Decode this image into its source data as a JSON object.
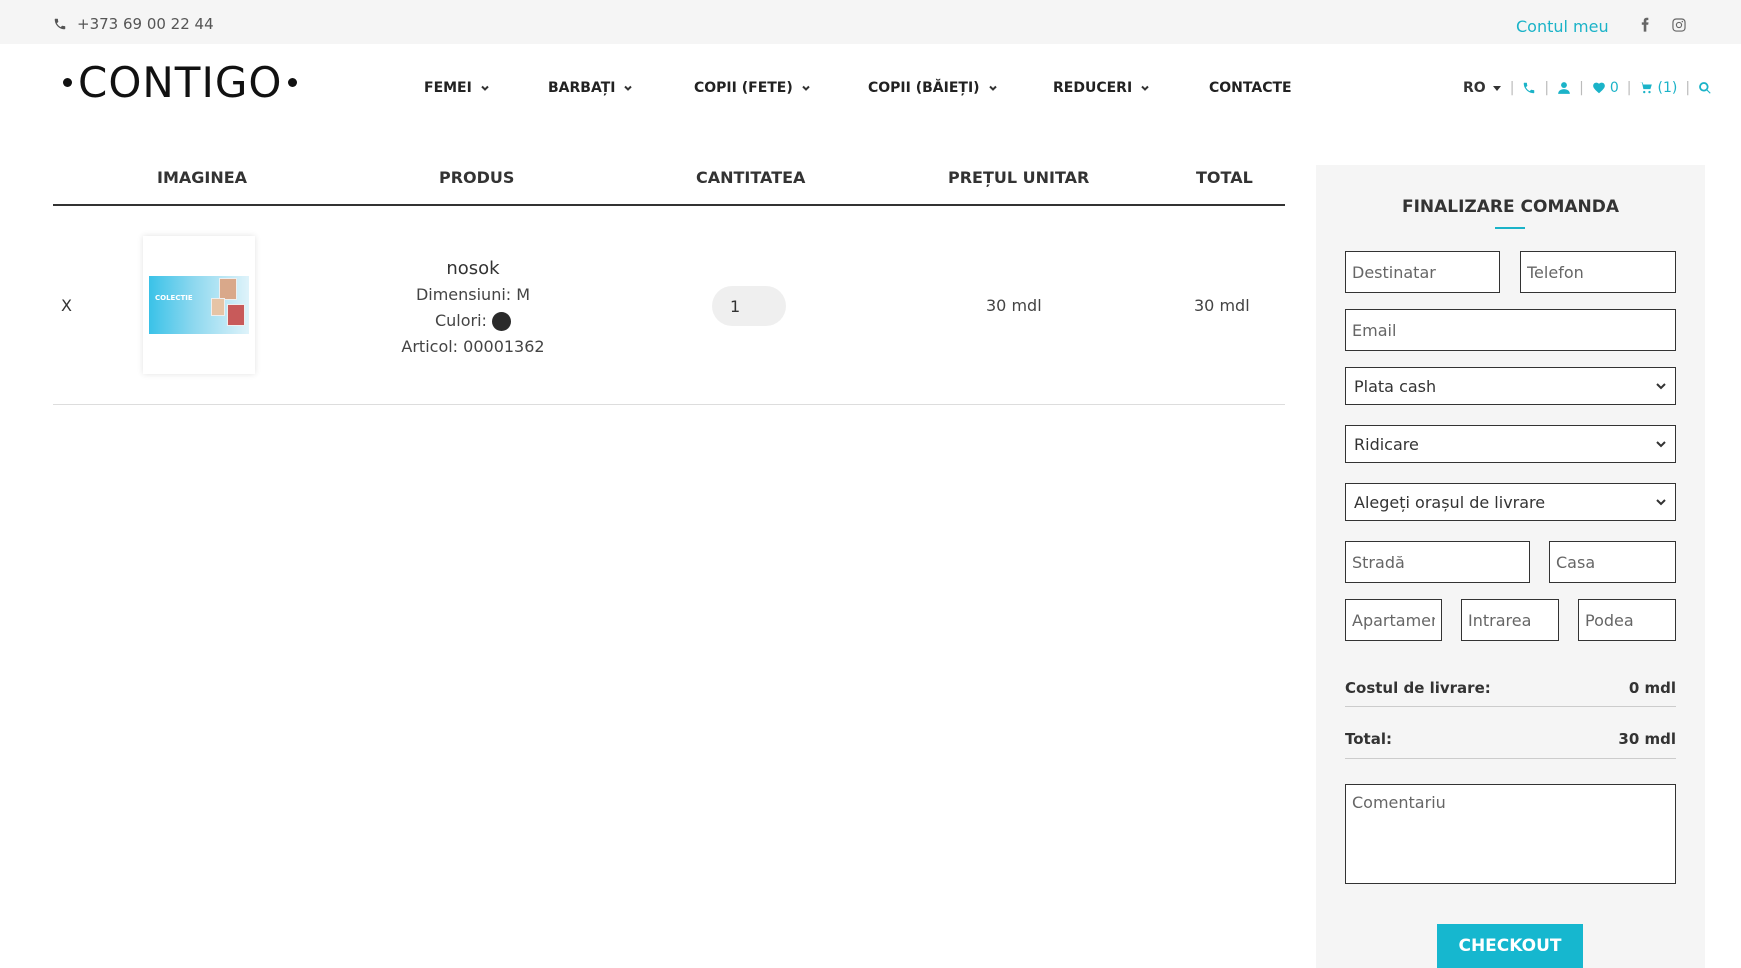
{
  "topbar": {
    "phone": "+373 69 00 22 44",
    "account": "Contul meu",
    "icons": [
      "phone-icon",
      "facebook-icon",
      "instagram-icon"
    ]
  },
  "header": {
    "logo": "CONTIGO",
    "nav": [
      {
        "label": "FEMEI",
        "dropdown": true
      },
      {
        "label": "BARBAȚI",
        "dropdown": true
      },
      {
        "label": "COPII (FETE)",
        "dropdown": true
      },
      {
        "label": "COPII (BĂIEȚI)",
        "dropdown": true
      },
      {
        "label": "REDUCERI",
        "dropdown": true
      },
      {
        "label": "CONTACTE",
        "dropdown": false
      }
    ],
    "lang": "RO",
    "wishlist_count": "0",
    "cart_count": "(1)"
  },
  "cart": {
    "columns": [
      "IMAGINEA",
      "PRODUS",
      "CANTITATEA",
      "PREȚUL UNITAR",
      "TOTAL"
    ],
    "item": {
      "remove": "X",
      "thumb_text": "COLECTIE",
      "name": "nosok",
      "size": "Dimensiuni: M",
      "colors_label": "Culori:",
      "article": "Articol: 00001362",
      "quantity": "1",
      "unit_price": "30 mdl",
      "total": "30 mdl"
    }
  },
  "checkout": {
    "title": "FINALIZARE COMANDA",
    "placeholders": {
      "recipient": "Destinatar",
      "phone": "Telefon",
      "email": "Email",
      "street": "Stradă",
      "house": "Casa",
      "apartment": "Apartament",
      "entrance": "Intrarea",
      "floor": "Podea",
      "comment": "Comentariu"
    },
    "payment": "Plata cash",
    "delivery": "Ridicare",
    "city": "Alegeți orașul de livrare",
    "shipping_label": "Costul de livrare:",
    "shipping_value": "0 mdl",
    "total_label": "Total:",
    "total_value": "30 mdl",
    "button": "CHECKOUT"
  },
  "colors": {
    "accent": "#1bb3c8",
    "button": "#16b7cf",
    "panel": "#f5f5f5"
  }
}
